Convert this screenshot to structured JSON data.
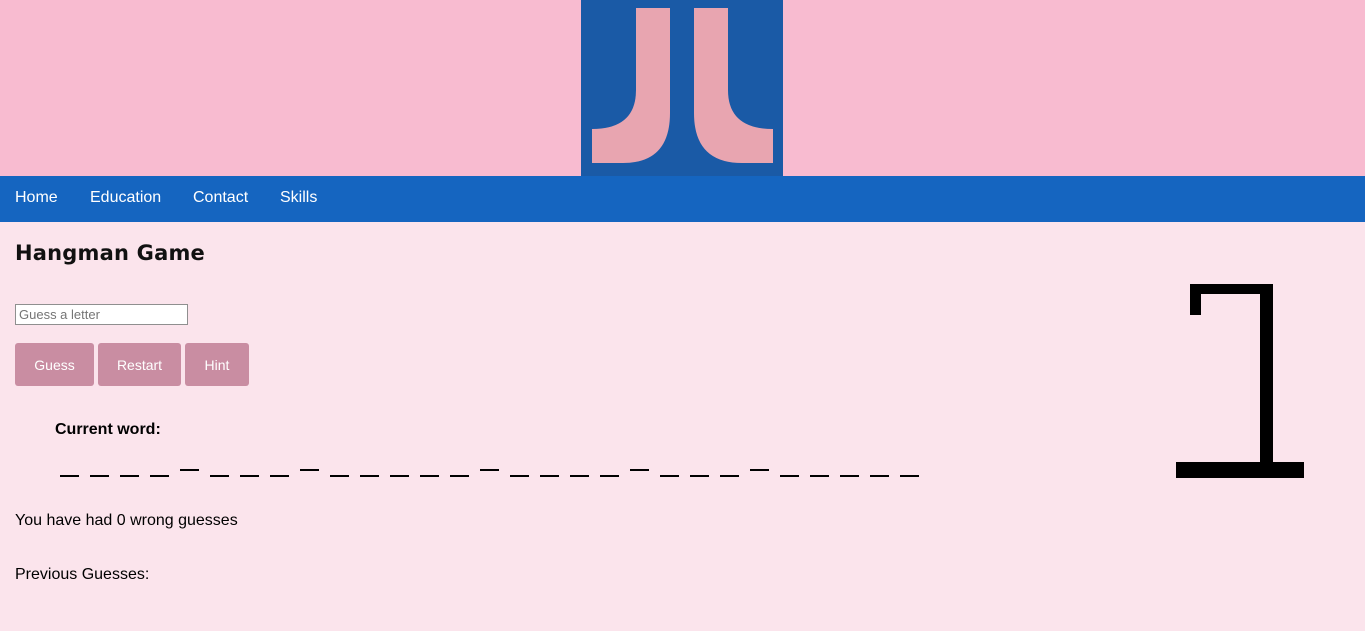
{
  "header": {
    "logo_text": "JL",
    "logo_colors": {
      "background": "#1a5aa6",
      "letters": "#e8a5b0"
    }
  },
  "nav": {
    "items": [
      {
        "label": "Home"
      },
      {
        "label": "Education"
      },
      {
        "label": "Contact"
      },
      {
        "label": "Skills"
      }
    ]
  },
  "game": {
    "title": "Hangman Game",
    "input_placeholder": "Guess a letter",
    "input_value": "",
    "buttons": {
      "guess": "Guess",
      "restart": "Restart",
      "hint": "Hint"
    },
    "current_word_label": "Current word:",
    "word_slots": [
      "blank",
      "blank",
      "blank",
      "blank",
      "space",
      "blank",
      "blank",
      "blank",
      "space",
      "blank",
      "blank",
      "blank",
      "blank",
      "blank",
      "space",
      "blank",
      "blank",
      "blank",
      "blank",
      "space",
      "blank",
      "blank",
      "blank",
      "space",
      "blank",
      "blank",
      "blank",
      "blank",
      "blank"
    ],
    "wrong_guesses_count": 0,
    "wrong_guesses_text": "You have had 0 wrong guesses",
    "previous_guesses_label": "Previous Guesses:",
    "previous_guesses": [],
    "hangman_stage": 0
  },
  "colors": {
    "banner": "#f8bbd0",
    "navbar": "#1565c0",
    "page_background": "#fbe4ec",
    "button": "#c98da2"
  }
}
